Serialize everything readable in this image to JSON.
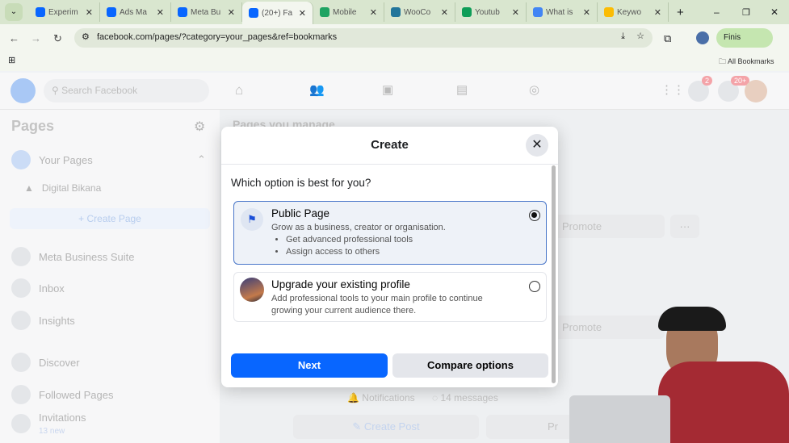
{
  "browser": {
    "tabs": [
      {
        "label": "Experim",
        "color": "#0866ff"
      },
      {
        "label": "Ads Ma",
        "color": "#0866ff"
      },
      {
        "label": "Meta Bu",
        "color": "#0866ff"
      },
      {
        "label": "(20+) Fa",
        "color": "#0866ff",
        "active": true
      },
      {
        "label": "Mobile",
        "color": "#1ea362"
      },
      {
        "label": "WooCo",
        "color": "#21759b"
      },
      {
        "label": "Youtub",
        "color": "#0f9d58"
      },
      {
        "label": "What is",
        "color": "#4285f4"
      },
      {
        "label": "Keywo",
        "color": "#fbbc04"
      }
    ],
    "url": "facebook.com/pages/?category=your_pages&ref=bookmarks",
    "profile_button": "Finis",
    "all_bookmarks": "All Bookmarks"
  },
  "facebook": {
    "search_placeholder": "Search Facebook",
    "messenger_badge": "2",
    "notifications_badge": "20+",
    "sidebar": {
      "title": "Pages",
      "your_pages": "Your Pages",
      "page_name": "Digital Bikana",
      "create_page": "+ Create Page",
      "items": [
        "Meta Business Suite",
        "Inbox",
        "Insights",
        "Discover",
        "Followed Pages",
        "Invitations"
      ],
      "invitations_sub": "13 new"
    },
    "main": {
      "heading": "Pages you manage",
      "promote": "Promote",
      "notifications": "Notifications",
      "messages": "14 messages",
      "create_post": "Create Post",
      "pr": "Pr"
    }
  },
  "modal": {
    "title": "Create",
    "question": "Which option is best for you?",
    "options": [
      {
        "title": "Public Page",
        "desc": "Grow as a business, creator or organisation.",
        "bullets": [
          "Get advanced professional tools",
          "Assign access to others"
        ],
        "selected": true
      },
      {
        "title": "Upgrade your existing profile",
        "desc": "Add professional tools to your main profile to continue growing your current audience there.",
        "selected": false
      }
    ],
    "next": "Next",
    "compare": "Compare options",
    "accent": "#0866ff"
  }
}
